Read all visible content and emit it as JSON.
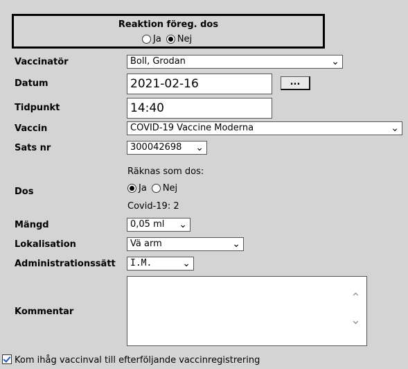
{
  "reaction": {
    "title": "Reaktion föreg. dos",
    "options": [
      {
        "label": "Ja",
        "checked": false
      },
      {
        "label": "Nej",
        "checked": true
      }
    ]
  },
  "form": {
    "vaccinator": {
      "label": "Vaccinatör",
      "value": "Boll, Grodan"
    },
    "datum": {
      "label": "Datum",
      "value": "2021-02-16",
      "button_label": "..."
    },
    "tidpunkt": {
      "label": "Tidpunkt",
      "value": "14:40"
    },
    "vaccin": {
      "label": "Vaccin",
      "value": "COVID-19 Vaccine Moderna"
    },
    "sats": {
      "label": "Sats nr",
      "value": "300042698"
    },
    "dos": {
      "label": "Dos",
      "counts_label": "Räknas som dos:",
      "options": [
        {
          "label": "Ja",
          "checked": true
        },
        {
          "label": "Nej",
          "checked": false
        }
      ],
      "covid_info": "Covid-19: 2"
    },
    "mangd": {
      "label": "Mängd",
      "value": "0,05 ml"
    },
    "lokalisation": {
      "label": "Lokalisation",
      "value": "Vä arm"
    },
    "administration": {
      "label": "Administrationssätt",
      "value": "I.M."
    },
    "kommentar": {
      "label": "Kommentar",
      "value": ""
    }
  },
  "remember": {
    "label": "Kom ihåg vaccinval till efterföljande vaccinregistrering",
    "checked": true
  }
}
